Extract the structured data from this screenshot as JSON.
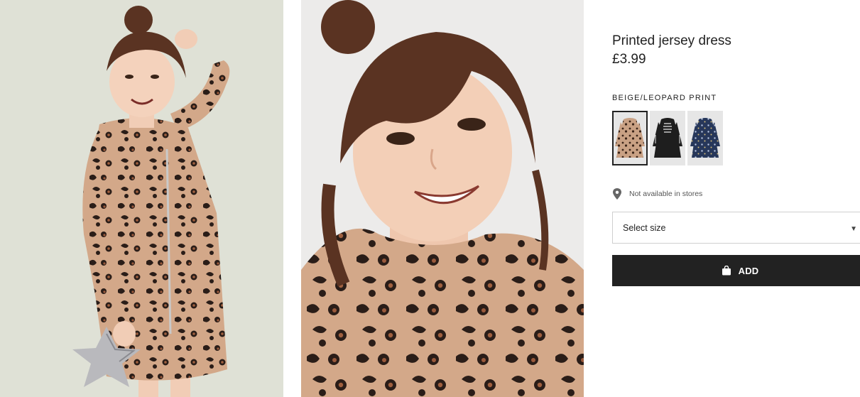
{
  "product": {
    "title": "Printed jersey dress",
    "price": "£3.99"
  },
  "colour": {
    "selected_label": "BEIGE/LEOPARD PRINT",
    "swatches": [
      {
        "name": "beige-leopard",
        "color": "#c9a184",
        "selected": true
      },
      {
        "name": "black-skeleton",
        "color": "#1e1e1e",
        "selected": false
      },
      {
        "name": "navy-print",
        "color": "#27375a",
        "selected": false
      }
    ]
  },
  "availability": {
    "text": "Not available in stores",
    "icon": "location-pin-icon"
  },
  "size": {
    "placeholder": "Select size"
  },
  "cart": {
    "add_label": "ADD",
    "icon": "shopping-bag-icon"
  },
  "theme": {
    "button_bg": "#222222",
    "leopard_base": "#d3a889",
    "photo_bg": "#dfe1d6"
  }
}
